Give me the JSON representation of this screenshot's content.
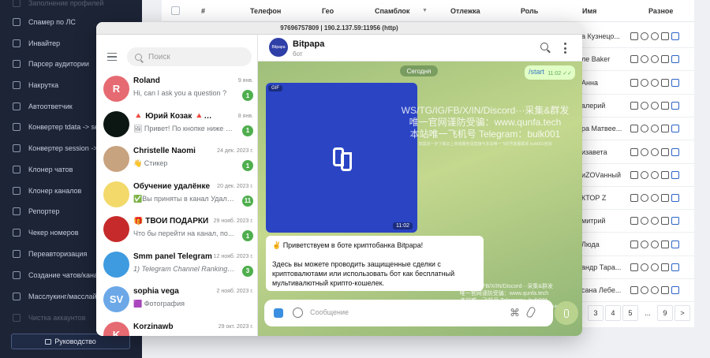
{
  "sidebar": {
    "items": [
      {
        "label": "Заполнение профилей",
        "dim": true
      },
      {
        "label": "Спамер по ЛС"
      },
      {
        "label": "Инвайтер"
      },
      {
        "label": "Парсер аудитории"
      },
      {
        "label": "Накрутка"
      },
      {
        "label": "Автоответчик"
      },
      {
        "label": "Конвертер tdata -> session"
      },
      {
        "label": "Конвертер session -> tdata"
      },
      {
        "label": "Клонер чатов"
      },
      {
        "label": "Клонер каналов"
      },
      {
        "label": "Репортер"
      },
      {
        "label": "Чекер номеров"
      },
      {
        "label": "Переавторизация"
      },
      {
        "label": "Создание чатов/каналов"
      },
      {
        "label": "Масслукинг/масслайкинг"
      },
      {
        "label": "Чистка аккаунтов",
        "dim": true
      }
    ],
    "guide_label": "Руководство"
  },
  "table": {
    "headers": [
      "#",
      "Телефон",
      "Гео",
      "Спамблок",
      "Отлежка",
      "Роль",
      "Имя",
      "Разное"
    ],
    "sort_icon": "▼",
    "rows": [
      {
        "name": "а Кузнецо..."
      },
      {
        "name": "ле Baker"
      },
      {
        "name": "Анна"
      },
      {
        "name": "алерий"
      },
      {
        "name": "ра Матвее..."
      },
      {
        "name": "изавета"
      },
      {
        "name": "иZOVанный"
      },
      {
        "name": "КТОР Z"
      },
      {
        "name": "митрий"
      },
      {
        "name": "Люда"
      },
      {
        "name": "андр Тара..."
      },
      {
        "name": "сана Лебе..."
      }
    ],
    "pagination": [
      "3",
      "4",
      "5",
      "...",
      "9",
      ">"
    ]
  },
  "telegram": {
    "window_title": "97696757809 | 190.2.137.59:11956 (http)",
    "search_placeholder": "Поиск",
    "chats": [
      {
        "name": "Roland",
        "date": "9 янв.",
        "preview": "Hi, can I ask you a question ?",
        "badge": "1",
        "avatar_letter": "R",
        "avatar_color": "#e66a72"
      },
      {
        "name": "🔺 Юрий Козак 🔺 Вводная ...",
        "date": "8 янв.",
        "preview": "🖼 Привет! По кнопке ниже вы ...",
        "badge": "1",
        "avatar_letter": "",
        "avatar_color": "#0c1713"
      },
      {
        "name": "Christelle Naomi",
        "date": "24 дек. 2023 г.",
        "preview": "👋 Стикер",
        "badge": "1",
        "avatar_letter": "",
        "avatar_color": "#c8a37f"
      },
      {
        "name": "Обучение удалёнке",
        "date": "20 дек. 2023 г.",
        "preview": "✅Вы приняты в канал Удалён...",
        "badge": "11",
        "avatar_letter": "",
        "avatar_color": "#f2d96a"
      },
      {
        "name": "🎁 ТВОИ ПОДАРКИ",
        "date": "29 нояб. 2023 г.",
        "preview": "Что бы перейти на канал, по...",
        "badge": "1",
        "avatar_letter": "",
        "avatar_color": "#c62a2a"
      },
      {
        "name": "Smm panel Telegram",
        "date": "12 нояб. 2023 г.",
        "preview": "1) Telegram Channel Ranking Ti...",
        "badge": "3",
        "avatar_letter": "",
        "avatar_color": "#3e9be0"
      },
      {
        "name": "sophia vega",
        "date": "2 нояб. 2023 г.",
        "preview": "🟪 Фотография",
        "badge": "",
        "avatar_letter": "SV",
        "avatar_color": "#6ca8e8"
      },
      {
        "name": "Korzinawb",
        "date": "29 окт. 2023 г.",
        "preview": "Привет! На связи Админ Корз...",
        "badge": "3",
        "avatar_letter": "K",
        "avatar_color": "#e66a72"
      }
    ],
    "bot": {
      "name": "Bitpapa",
      "status": "бот",
      "avatar_text": "Bitpapa"
    },
    "date_pill": "Сегодня",
    "out_message": {
      "text": "/start",
      "time": "11:02"
    },
    "gif": {
      "tag": "GIF",
      "time": "11:02"
    },
    "in_message": {
      "p1": "✌️ Приветствуем в боте криптобанка Bitpapa!",
      "p2": "Здесь вы можете проводить защищенные сделки с криптовалютами или использовать бот как бесплатный мультивалютный крипто-кошелек."
    },
    "composer_placeholder": "Сообщение",
    "watermark": {
      "line1": "WS/TG/IG/FB/X/IN/Discord···采集&群发",
      "line2": "唯一官网谨防受骗：www.qunfa.tech",
      "line3": "本站唯一飞机号 Telegram：bulk001",
      "line4": "如需进一步了解云上商城服务请直接与本站唯一飞机号客服联系 bulk001咨询"
    }
  }
}
